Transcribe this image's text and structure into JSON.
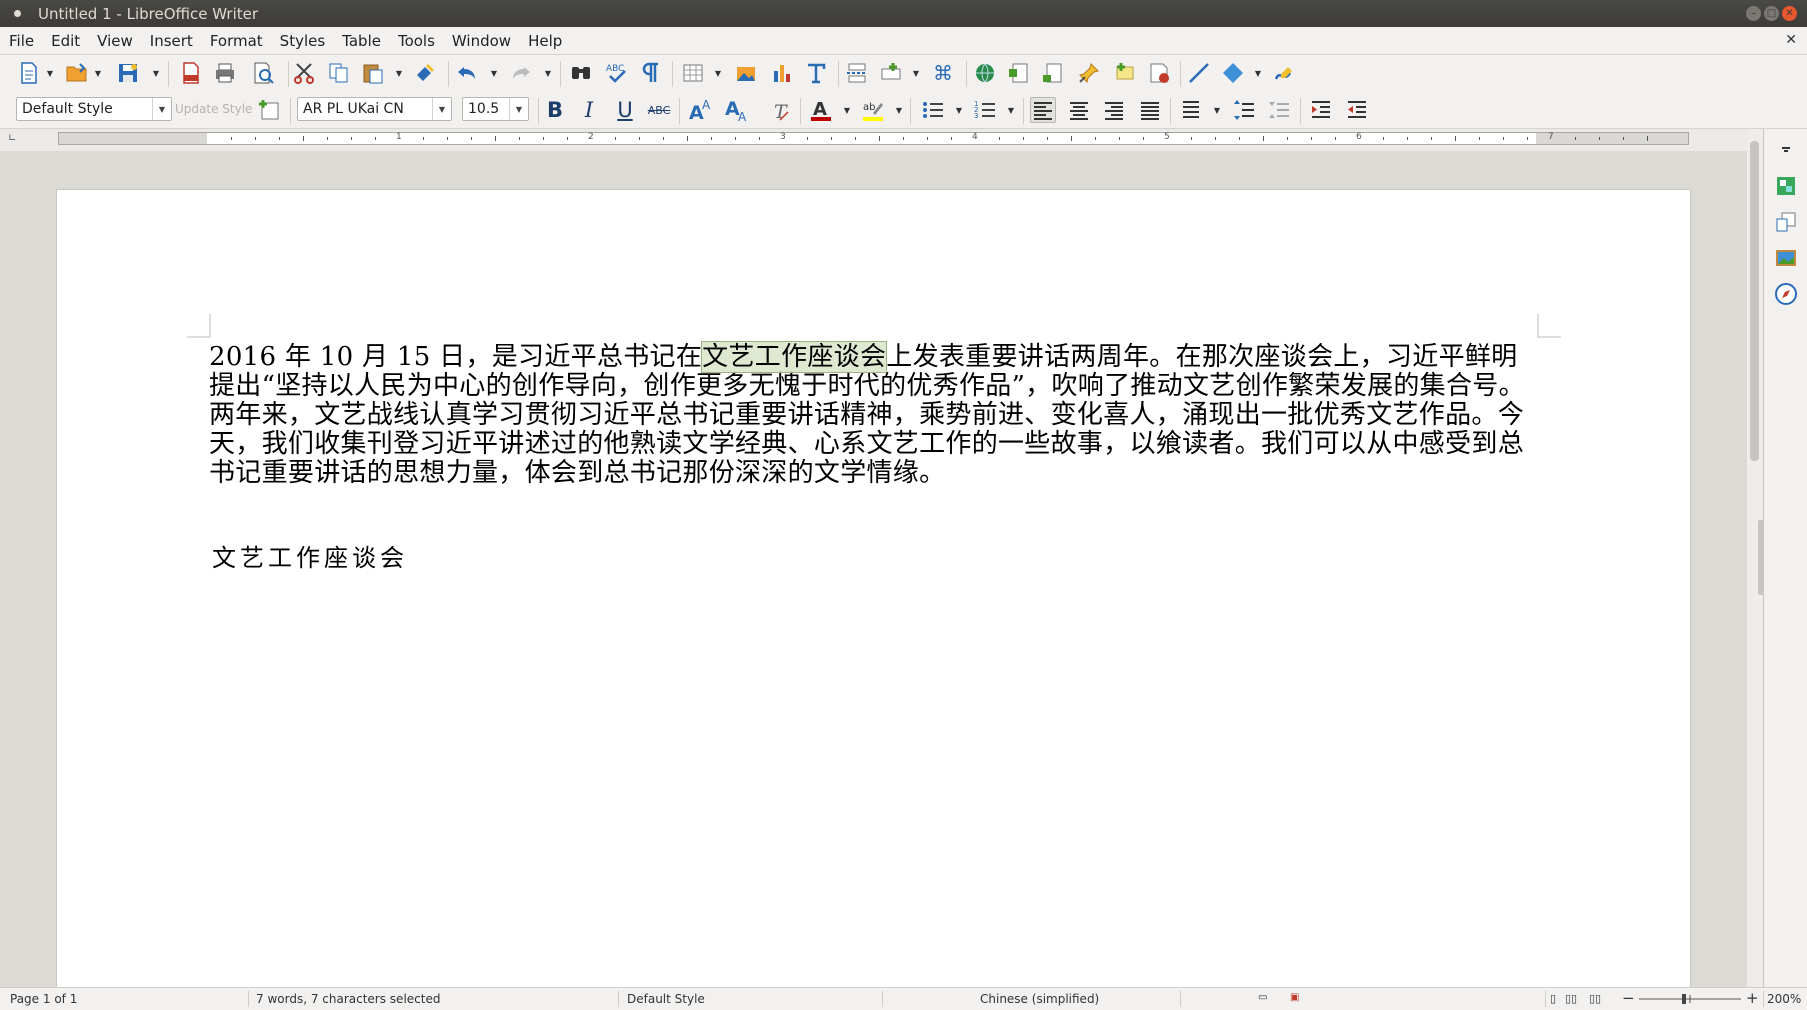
{
  "window": {
    "title": "Untitled 1 - LibreOffice Writer"
  },
  "menu": [
    "File",
    "Edit",
    "View",
    "Insert",
    "Format",
    "Styles",
    "Table",
    "Tools",
    "Window",
    "Help"
  ],
  "formatting": {
    "paragraph_style": "Default Style",
    "update_style_label": "Update Style",
    "font_name": "AR PL UKai CN",
    "font_size": "10.5",
    "bold_label": "B",
    "italic_label": "I",
    "underline_label": "U",
    "strike_label": "ABC"
  },
  "ruler": {
    "numbers": [
      "1",
      "2",
      "3",
      "4",
      "5",
      "6",
      "7"
    ]
  },
  "document": {
    "para_part1": "2016 年 10 月 15 日，是习近平总书记在",
    "para_highlight": "文艺工作座谈会",
    "para_part2": "上发表重要讲话两周年。在那次座谈会上，习近平鲜明提出“坚持以人民为中心的创作导向，创作更多无愧于时代的优秀作品”，吹响了推动文艺创作繁荣发展的集合号。两年来，文艺战线认真学习贯彻习近平总书记重要讲话精神，乘势前进、变化喜人，涌现出一批优秀文艺作品。今天，我们收集刊登习近平讲述过的他熟读文学经典、心系文艺工作的一些故事，以飨读者。我们可以从中感受到总书记重要讲话的思想力量，体会到总书记那份深深的文学情缘。",
    "heading": "文艺工作座谈会"
  },
  "status": {
    "page": "Page 1 of 1",
    "words": "7 words, 7 characters selected",
    "style": "Default Style",
    "language": "Chinese (simplified)",
    "zoom_minus": "−",
    "zoom_plus": "+",
    "zoom": "200%"
  },
  "colors": {
    "highlight_bg": "#dfe9d1",
    "font_color_bar": "#c00000",
    "highlight_color_bar": "#ffff00",
    "titlebar": "#3c3b37",
    "close_button": "#e6572d"
  }
}
